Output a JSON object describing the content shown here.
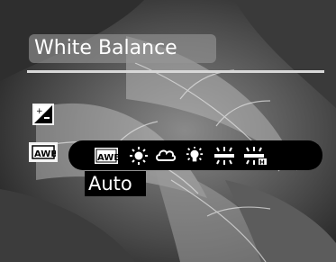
{
  "menu": {
    "title": "White Balance"
  },
  "side_icons": [
    {
      "name": "exposure-compensation-icon",
      "glyph": "+/−"
    },
    {
      "name": "white-balance-icon",
      "glyph": "AWB"
    }
  ],
  "wb_options": [
    {
      "name": "awb-icon",
      "glyph": "AWB",
      "selected": true
    },
    {
      "name": "daylight-icon",
      "glyph": "sun"
    },
    {
      "name": "cloudy-icon",
      "glyph": "cloud"
    },
    {
      "name": "tungsten-icon",
      "glyph": "bulb"
    },
    {
      "name": "fluorescent-icon",
      "glyph": "fluorescent"
    },
    {
      "name": "fluorescent-h-icon",
      "glyph": "fluorescent H"
    }
  ],
  "selected_option": {
    "label": "Auto"
  },
  "colors": {
    "strip": "#000000",
    "text": "#ffffff",
    "title_box": "#969696"
  }
}
